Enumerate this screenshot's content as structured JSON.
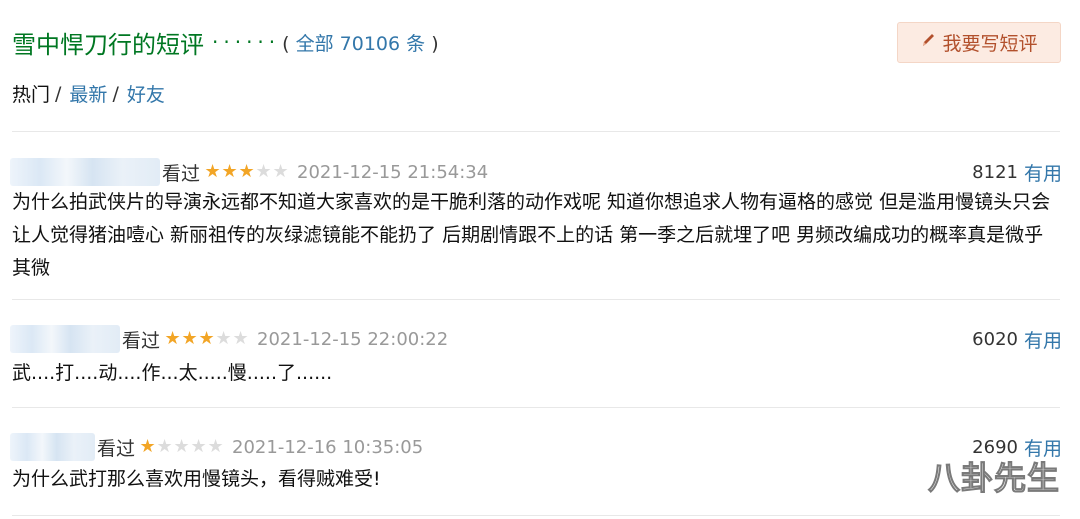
{
  "header": {
    "title": "雪中悍刀行的短评",
    "dots": "······",
    "count_open": "(",
    "count_text": "全部 70106 条",
    "count_close": ")",
    "write_button": "我要写短评"
  },
  "tabs": [
    {
      "label": "热门",
      "active": true
    },
    {
      "label": "最新",
      "active": false
    },
    {
      "label": "好友",
      "active": false
    }
  ],
  "tab_separator": "/",
  "comments": [
    {
      "status": "看过",
      "rating": 3,
      "time": "2021-12-15 21:54:34",
      "votes": "8121",
      "useful_label": "有用",
      "content": "为什么拍武侠片的导演永远都不知道大家喜欢的是干脆利落的动作戏呢 知道你想追求人物有逼格的感觉 但是滥用慢镜头只会让人觉得猪油噎心 新丽祖传的灰绿滤镜能不能扔了 后期剧情跟不上的话 第一季之后就埋了吧 男频改编成功的概率真是微乎其微"
    },
    {
      "status": "看过",
      "rating": 3,
      "time": "2021-12-15 22:00:22",
      "votes": "6020",
      "useful_label": "有用",
      "content": "武....打....动....作...太.....慢.....了......"
    },
    {
      "status": "看过",
      "rating": 1,
      "time": "2021-12-16 10:35:05",
      "votes": "2690",
      "useful_label": "有用",
      "content": "为什么武打那么喜欢用慢镜头，看得贼难受!"
    }
  ],
  "watermark": "八卦先生",
  "colors": {
    "green": "#007722",
    "link_blue": "#3377aa",
    "star": "#f2a526",
    "button_bg": "#fcebe2",
    "button_text": "#b2502c"
  },
  "icons": {
    "pencil": "pencil-icon",
    "star": "star-icon"
  }
}
